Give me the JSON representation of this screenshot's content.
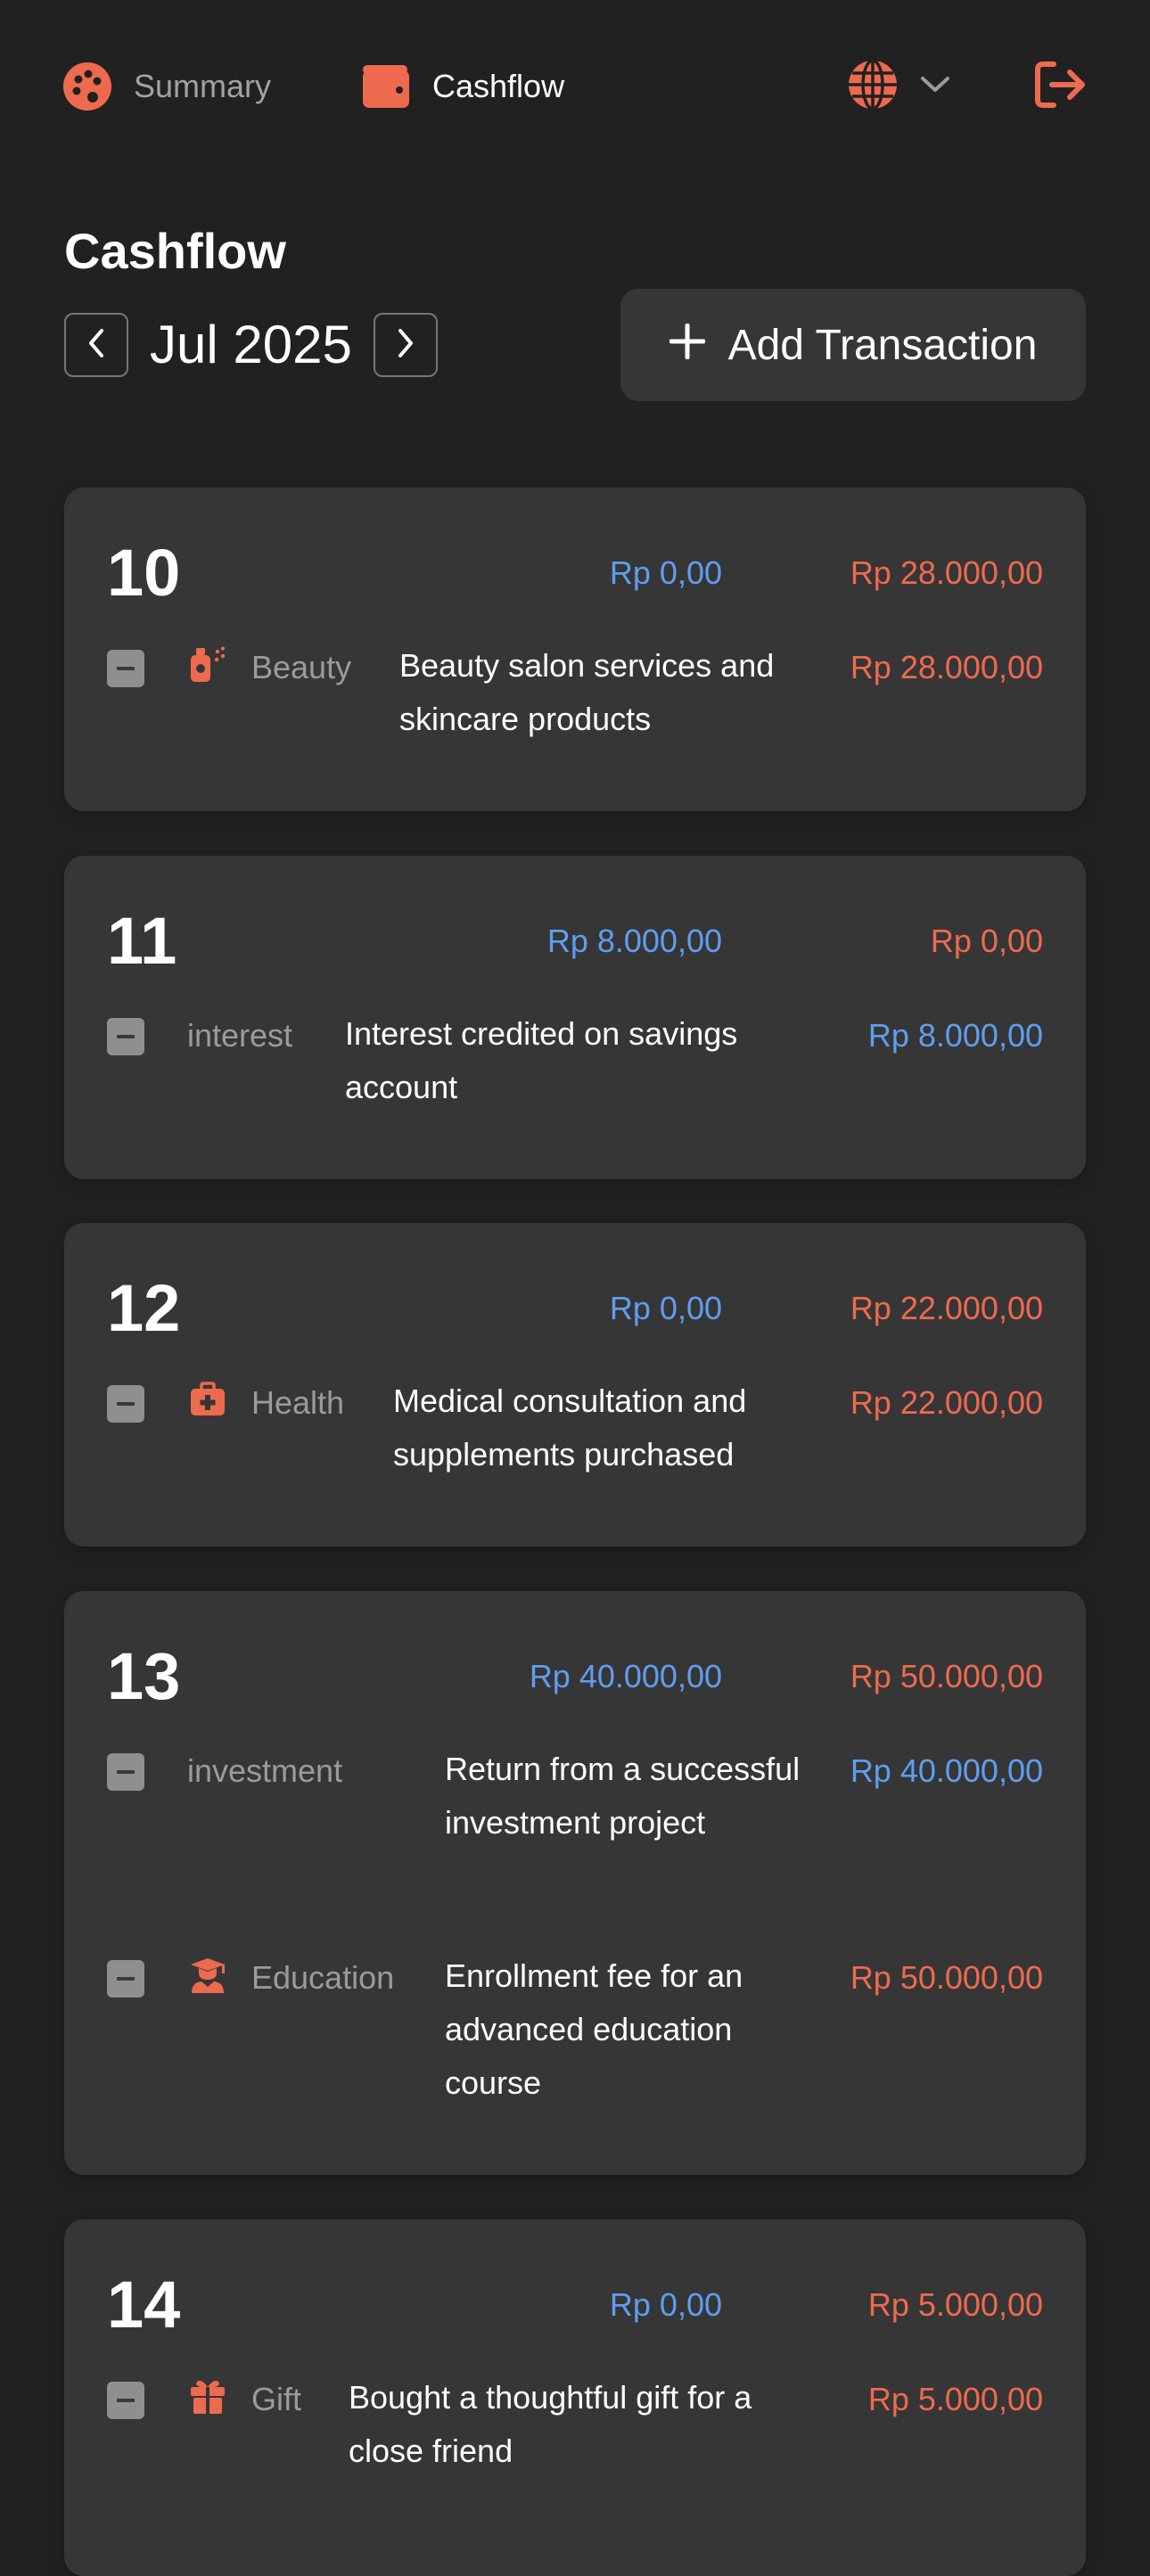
{
  "nav": {
    "summary_label": "Summary",
    "cashflow_label": "Cashflow",
    "accent_color": "#ee6a4f"
  },
  "header": {
    "title": "Cashflow",
    "month": "Jul 2025",
    "add_label": "Add Transaction"
  },
  "days": [
    {
      "day": "10",
      "income": "Rp 0,00",
      "expense": "Rp 28.000,00",
      "transactions": [
        {
          "category": "Beauty",
          "icon": "beauty-icon",
          "description": "Beauty salon services and skincare products",
          "amount": "Rp 28.000,00",
          "type": "expense"
        }
      ]
    },
    {
      "day": "11",
      "income": "Rp 8.000,00",
      "expense": "Rp 0,00",
      "transactions": [
        {
          "category": "interest",
          "icon": "",
          "description": "Interest credited on savings account",
          "amount": "Rp 8.000,00",
          "type": "income"
        }
      ]
    },
    {
      "day": "12",
      "income": "Rp 0,00",
      "expense": "Rp 22.000,00",
      "transactions": [
        {
          "category": "Health",
          "icon": "medical-kit-icon",
          "description": "Medical consultation and supplements purchased",
          "amount": "Rp 22.000,00",
          "type": "expense"
        }
      ]
    },
    {
      "day": "13",
      "income": "Rp 40.000,00",
      "expense": "Rp 50.000,00",
      "transactions": [
        {
          "category": "investment",
          "icon": "",
          "description": "Return from a successful investment project",
          "amount": "Rp 40.000,00",
          "type": "income"
        },
        {
          "category": "Education",
          "icon": "graduate-icon",
          "description": "Enrollment fee for an advanced education course",
          "amount": "Rp 50.000,00",
          "type": "expense"
        }
      ]
    },
    {
      "day": "14",
      "income": "Rp 0,00",
      "expense": "Rp 5.000,00",
      "transactions": [
        {
          "category": "Gift",
          "icon": "gift-icon",
          "description": "Bought a thoughtful gift for a close friend",
          "amount": "Rp 5.000,00",
          "type": "expense"
        }
      ]
    }
  ]
}
